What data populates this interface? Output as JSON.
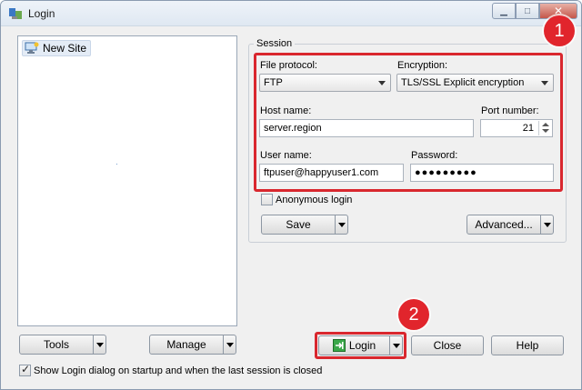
{
  "window": {
    "title": "Login"
  },
  "titlebar": {
    "minimize_icon": "minimize-icon",
    "maximize_icon": "maximize-icon",
    "close_icon": "close-icon"
  },
  "site_tree": {
    "items": [
      {
        "label": "New Site",
        "icon": "new-site-icon"
      }
    ]
  },
  "session": {
    "group_label": "Session",
    "file_protocol_label": "File protocol:",
    "file_protocol_value": "FTP",
    "encryption_label": "Encryption:",
    "encryption_value": "TLS/SSL Explicit encryption",
    "host_name_label": "Host name:",
    "host_name_value": "server.region",
    "port_number_label": "Port number:",
    "port_number_value": "21",
    "user_name_label": "User name:",
    "user_name_value": "ftpuser@happyuser1.com",
    "password_label": "Password:",
    "password_value": "●●●●●●●●●",
    "anonymous_login_label": "Anonymous login",
    "anonymous_login_checked": false,
    "save_label": "Save",
    "advanced_label": "Advanced..."
  },
  "bottom_left": {
    "tools_label": "Tools",
    "manage_label": "Manage"
  },
  "footer": {
    "login_label": "Login",
    "close_label": "Close",
    "help_label": "Help",
    "show_login_label": "Show Login dialog on startup and when the last session is closed",
    "show_login_checked": true
  },
  "annotations": {
    "badge_1": "1",
    "badge_2": "2",
    "highlight_color": "#d9272e",
    "badge_color": "#e1252c"
  }
}
